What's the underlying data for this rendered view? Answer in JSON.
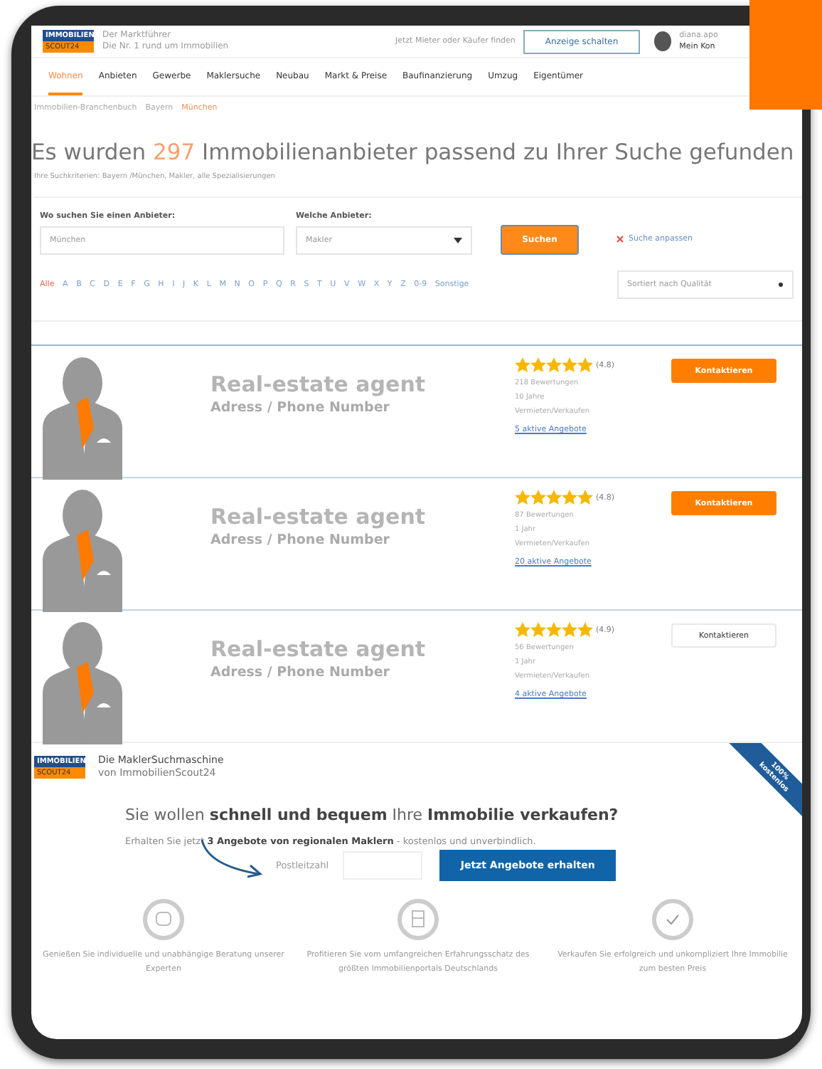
{
  "header": {
    "logo": {
      "top": "IMMOBILIEN",
      "bottom": "SCOUT24"
    },
    "tagline": [
      "Der Marktführer",
      "Die Nr. 1 rund um Immobilien"
    ],
    "cta_text": "Jetzt Mieter oder Käufer finden",
    "cta_button": "Anzeige schalten",
    "user": [
      "diana.apo",
      "Mein Kon"
    ]
  },
  "nav": [
    {
      "label": "Wohnen",
      "selected": true
    },
    {
      "label": "Anbieten",
      "selected": false
    },
    {
      "label": "Gewerbe",
      "selected": false
    },
    {
      "label": "Maklersuche",
      "selected": false
    },
    {
      "label": "Neubau",
      "selected": false
    },
    {
      "label": "Markt & Preise",
      "selected": false
    },
    {
      "label": "Baufinanzierung",
      "selected": false
    },
    {
      "label": "Umzug",
      "selected": false
    },
    {
      "label": "Eigentümer",
      "selected": false
    }
  ],
  "breadcrumb": [
    {
      "label": "Immobilien-Branchenbuch",
      "selected": false
    },
    {
      "label": "Bayern",
      "selected": false
    },
    {
      "label": "München",
      "selected": true
    }
  ],
  "heading": {
    "before": "Es wurden",
    "count": "297",
    "after": "Immobilienanbieter passend zu Ihrer Suche gefunden"
  },
  "criteria": "Ihre Suchkriterien: Bayern /München, Makler, alle Spezialisierungen",
  "search": {
    "where_label": "Wo suchen Sie einen Anbieter:",
    "where_value": "München",
    "type_label": "Welche Anbieter:",
    "type_value": "Makler",
    "button": "Suchen",
    "adjust_link": "Suche anpassen"
  },
  "letters": [
    {
      "label": "Alle",
      "selected": true
    },
    {
      "label": "A",
      "selected": false
    },
    {
      "label": "B",
      "selected": false
    },
    {
      "label": "C",
      "selected": false
    },
    {
      "label": "D",
      "selected": false
    },
    {
      "label": "E",
      "selected": false
    },
    {
      "label": "F",
      "selected": false
    },
    {
      "label": "G",
      "selected": false
    },
    {
      "label": "H",
      "selected": false
    },
    {
      "label": "I",
      "selected": false
    },
    {
      "label": "J",
      "selected": false
    },
    {
      "label": "K",
      "selected": false
    },
    {
      "label": "L",
      "selected": false
    },
    {
      "label": "M",
      "selected": false
    },
    {
      "label": "N",
      "selected": false
    },
    {
      "label": "O",
      "selected": false
    },
    {
      "label": "P",
      "selected": false
    },
    {
      "label": "Q",
      "selected": false
    },
    {
      "label": "R",
      "selected": false
    },
    {
      "label": "S",
      "selected": false
    },
    {
      "label": "T",
      "selected": false
    },
    {
      "label": "U",
      "selected": false
    },
    {
      "label": "V",
      "selected": false
    },
    {
      "label": "W",
      "selected": false
    },
    {
      "label": "X",
      "selected": false
    },
    {
      "label": "Y",
      "selected": false
    },
    {
      "label": "Z",
      "selected": false
    },
    {
      "label": "0-9",
      "selected": false
    },
    {
      "label": "Sonstige",
      "selected": false
    }
  ],
  "sort": "Sortiert nach Qualität",
  "listings": [
    {
      "name": "Real-estate agent",
      "contact": "Adress / Phone Number",
      "stars": 5,
      "rating": "(4.8)",
      "details": [
        "218 Bewertungen",
        "10 Jahre",
        "Vermieten/Verkaufen"
      ],
      "offers": "5 aktive Angebote",
      "button": {
        "label": "Kontaktieren",
        "kind": "filled"
      }
    },
    {
      "name": "Real-estate agent",
      "contact": "Adress / Phone Number",
      "stars": 5,
      "rating": "(4.8)",
      "details": [
        "87 Bewertungen",
        "1 Jahr",
        "Vermieten/Verkaufen"
      ],
      "offers": "20 aktive Angebote",
      "button": {
        "label": "Kontaktieren",
        "kind": "filled"
      }
    },
    {
      "name": "Real-estate agent",
      "contact": "Adress / Phone Number",
      "stars": 5,
      "rating": "(4.9)",
      "details": [
        "56 Bewertungen",
        "1 Jahr",
        "Vermieten/Verkaufen"
      ],
      "offers": "4 aktive Angebote",
      "button": {
        "label": "Kontaktieren",
        "kind": "outline"
      }
    }
  ],
  "promo": {
    "logo": {
      "top": "IMMOBILIEN",
      "bottom": "SCOUT24"
    },
    "brand": [
      "Die MaklerSuchmaschine",
      "von ImmobilienScout24"
    ],
    "ribbon": [
      "100%",
      "kostenlos"
    ],
    "headline": "Sie wollen **schnell und bequem** Ihre **Immobilie verkaufen?**",
    "subline": "Erhalten Sie jetzt **3 Angebote von regionalen Maklern** - kostenlos und unverbindlich.",
    "zip_label": "Postleitzahl",
    "button": "Jetzt Angebote erhalten",
    "features": [
      {
        "kind": "chat",
        "text": "Genießen Sie individuelle und unabhängige Beratung unserer Experten"
      },
      {
        "kind": "house",
        "text": "Profitieren Sie vom umfangreichen Erfahrungsschatz des größten Immobilienportals Deutschlands"
      },
      {
        "kind": "check",
        "text": "Verkaufen Sie erfolgreich und unkompliziert Ihre Immobilie zum besten Preis"
      }
    ]
  }
}
